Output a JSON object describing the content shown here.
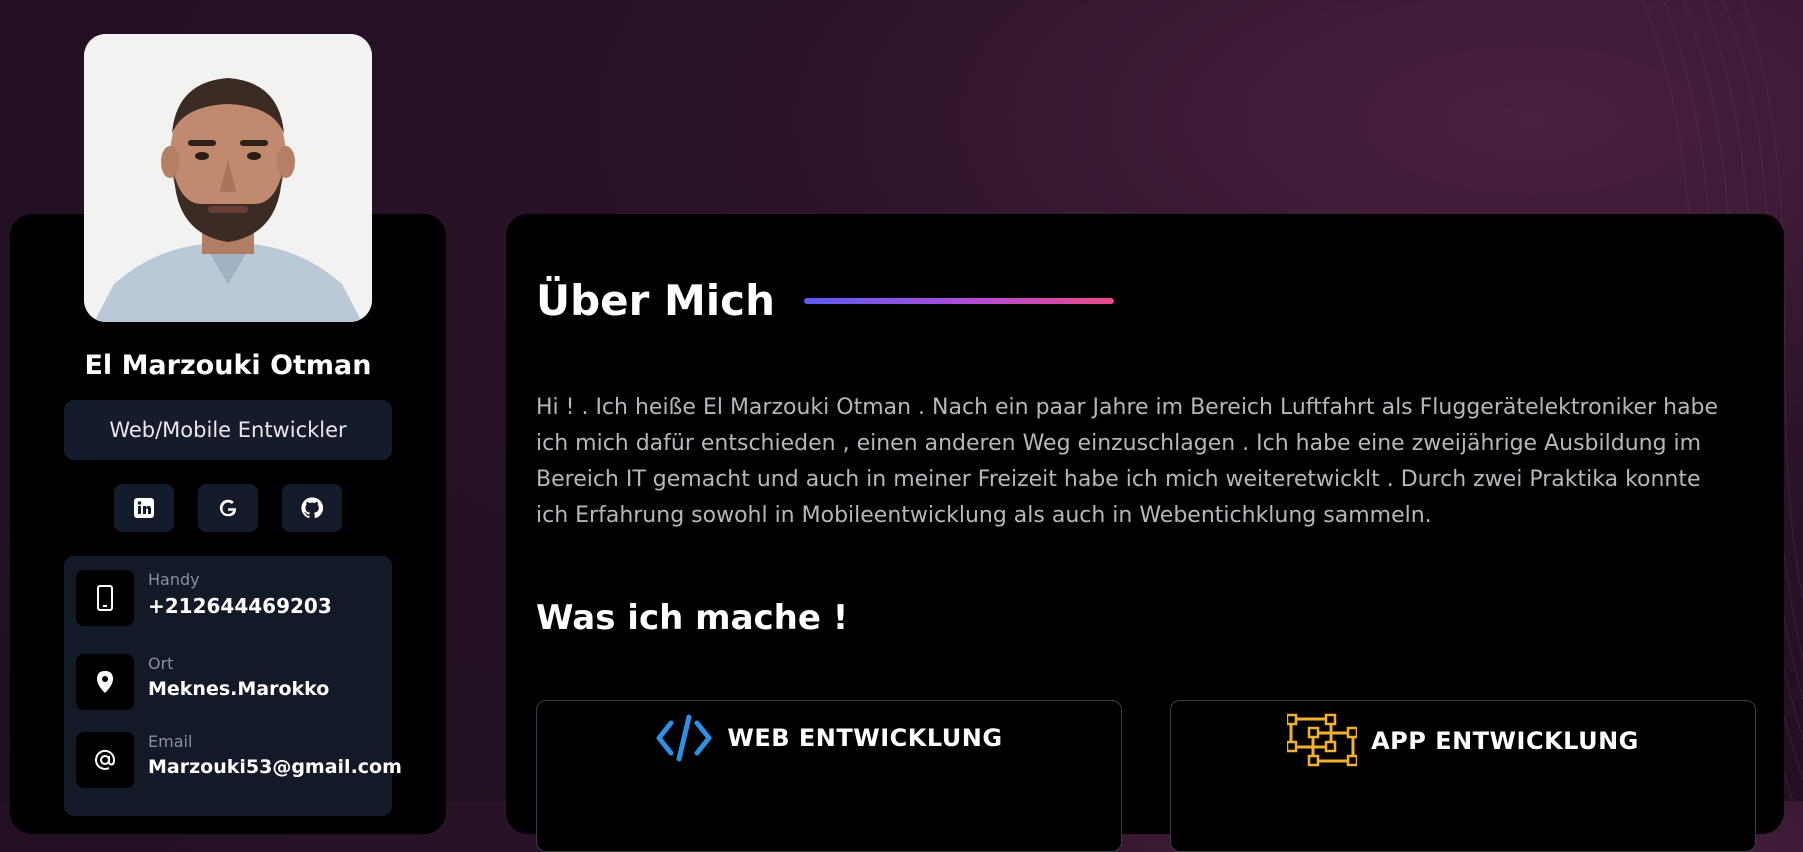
{
  "profile": {
    "name": "El Marzouki Otman",
    "role": "Web/Mobile Entwickler",
    "socials": [
      {
        "icon": "linkedin-icon"
      },
      {
        "icon": "google-icon"
      },
      {
        "icon": "github-icon"
      }
    ],
    "contacts": [
      {
        "label": "Handy",
        "value": "+212644469203",
        "icon": "phone-icon"
      },
      {
        "label": "Ort",
        "value": "Meknes.Marokko",
        "icon": "location-pin-icon"
      },
      {
        "label": "Email",
        "value": "Marzouki53@gmail.com",
        "icon": "at-sign-icon"
      }
    ]
  },
  "about": {
    "title": "Über Mich",
    "text": "Hi ! . Ich heiße El Marzouki Otman . Nach ein paar Jahre im Bereich Luftfahrt als Fluggerätelektroniker habe ich mich dafür entschieden , einen anderen Weg einzuschlagen . Ich habe eine zweijährige Ausbildung im Bereich IT gemacht und auch in meiner Freizeit habe ich mich weiteretwicklt . Durch zwei Praktika konnte ich Erfahrung sowohl in Mobileentwicklung als auch in Webentichklung sammeln."
  },
  "services": {
    "title": "Was ich mache !",
    "items": [
      {
        "title": "WEB ENTWICKLUNG",
        "icon": "code-icon"
      },
      {
        "title": "APP ENTWICKLUNG",
        "icon": "nodes-icon"
      }
    ]
  },
  "colors": {
    "accent_start": "#5a5cf2",
    "accent_end": "#ea4a86",
    "web_icon": "#2d8fe6",
    "app_icon": "#f0b22c"
  }
}
